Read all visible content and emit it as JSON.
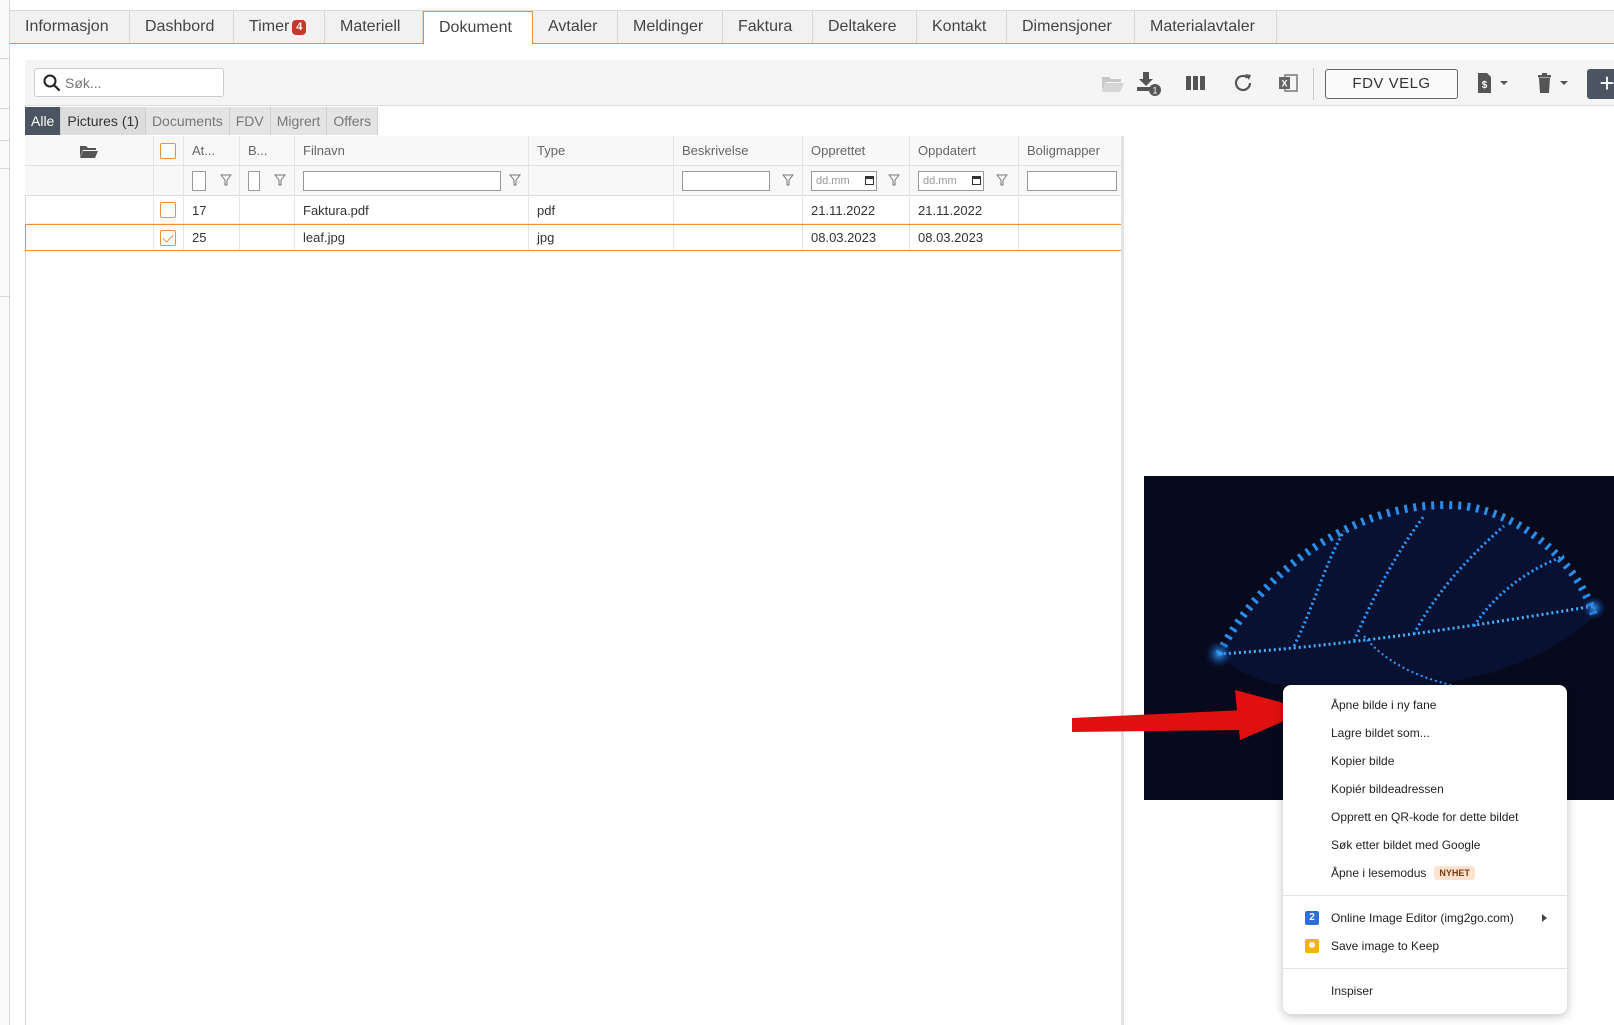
{
  "tabs": [
    {
      "label": "Informasjon",
      "active": false
    },
    {
      "label": "Dashbord",
      "active": false
    },
    {
      "label": "Timer",
      "active": false,
      "badge": "4"
    },
    {
      "label": "Materiell",
      "active": false
    },
    {
      "label": "Dokument",
      "active": true
    },
    {
      "label": "Avtaler",
      "active": false
    },
    {
      "label": "Meldinger",
      "active": false
    },
    {
      "label": "Faktura",
      "active": false
    },
    {
      "label": "Deltakere",
      "active": false
    },
    {
      "label": "Kontakt",
      "active": false
    },
    {
      "label": "Dimensjoner",
      "active": false
    },
    {
      "label": "Materialavtaler",
      "active": false
    }
  ],
  "toolbar": {
    "search_placeholder": "Søk...",
    "fdv_button": "FDV VELG",
    "download_badge": "1",
    "plus_label": "+"
  },
  "filter_tabs": [
    {
      "label": "Alle",
      "state": "active"
    },
    {
      "label": "Pictures (1)",
      "state": "selected"
    },
    {
      "label": "Documents",
      "state": "normal"
    },
    {
      "label": "FDV",
      "state": "normal"
    },
    {
      "label": "Migrert",
      "state": "normal"
    },
    {
      "label": "Offers",
      "state": "normal"
    }
  ],
  "grid": {
    "columns": [
      "At...",
      "B...",
      "Filnavn",
      "Type",
      "Beskrivelse",
      "Opprettet",
      "Oppdatert",
      "Boligmapper"
    ],
    "date_placeholder": "dd.mm",
    "rows": [
      {
        "at": "17",
        "b": "",
        "filnavn": "Faktura.pdf",
        "type": "pdf",
        "beskrivelse": "",
        "opprettet": "21.11.2022",
        "oppdatert": "21.11.2022",
        "boligmapper": "",
        "checked": false
      },
      {
        "at": "25",
        "b": "",
        "filnavn": "leaf.jpg",
        "type": "jpg",
        "beskrivelse": "",
        "opprettet": "08.03.2023",
        "oppdatert": "08.03.2023",
        "boligmapper": "",
        "checked": true
      }
    ]
  },
  "context_menu": {
    "items": [
      "Åpne bilde i ny fane",
      "Lagre bildet som...",
      "Kopier bilde",
      "Kopiér bildeadressen",
      "Opprett en QR-kode for dette bildet",
      "Søk etter bildet med Google",
      "Åpne i lesemodus"
    ],
    "new_badge": "NYHET",
    "extensions": [
      {
        "label": "Online Image Editor (img2go.com)",
        "icon_text": "2",
        "icon_color": "#2f6fd8",
        "submenu": true
      },
      {
        "label": "Save image to Keep",
        "icon_text": "",
        "icon_color": "#f6b400",
        "submenu": false
      }
    ],
    "inspect": "Inspiser"
  },
  "colors": {
    "accent": "#e8913a",
    "dark": "#4a5561",
    "badge_red": "#c0392b",
    "arrow_red": "#e01010"
  }
}
